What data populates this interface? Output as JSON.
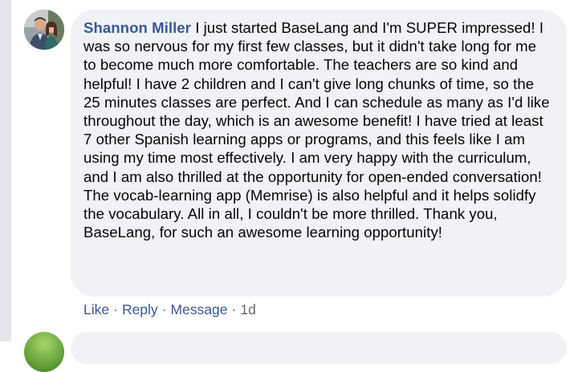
{
  "comment": {
    "author": "Shannon Miller",
    "text": "I just started BaseLang and I'm SUPER impressed! I was so nervous for my first few classes, but it didn't take long for me to become much more comfortable. The teachers are so kind and helpful! I have 2 children and I can't give long chunks of time, so the 25 minutes classes are perfect. And I can schedule as many as I'd like throughout the day, which is an awesome benefit! I have tried at least 7 other Spanish learning apps or programs, and this feels like I am using my time most effectively. I am very happy with the curriculum, and I am also thrilled at the opportunity for open-ended conversation! The vocab-learning app (Memrise) is also helpful and it helps solidfy the vocabulary. All in all, I couldn't be more thrilled. Thank you, BaseLang, for such an awesome learning opportunity!",
    "actions": {
      "like": "Like",
      "reply": "Reply",
      "message": "Message",
      "separator": "·",
      "time": "1d"
    }
  },
  "colors": {
    "author": "#385898",
    "bubble": "#f0f2f5",
    "text": "#050505",
    "meta": "#65676b"
  }
}
